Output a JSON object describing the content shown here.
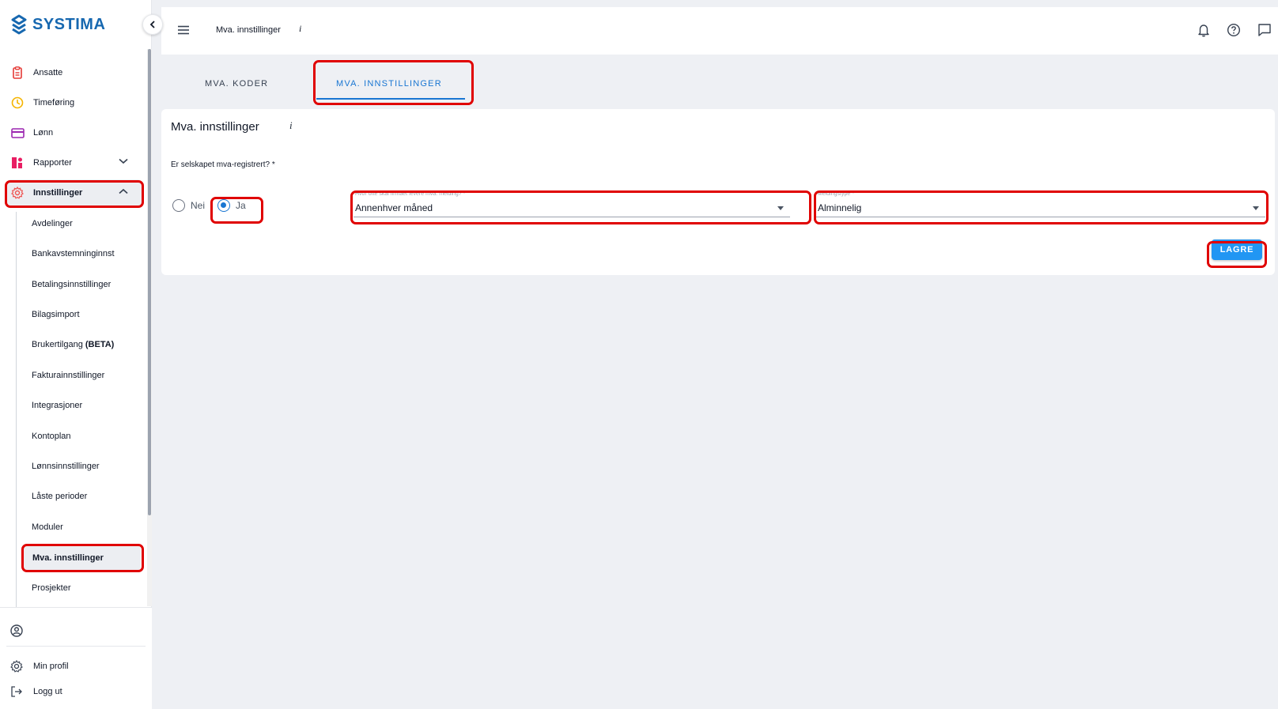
{
  "brand": {
    "name": "SYSTIMA",
    "color": "#1768b0"
  },
  "sidebar": {
    "items": [
      {
        "label": "Ansatte",
        "icon": "clipboard-icon",
        "color": "#e53935"
      },
      {
        "label": "Timeføring",
        "icon": "clock-icon",
        "color": "#f5b400"
      },
      {
        "label": "Lønn",
        "icon": "credit-card-icon",
        "color": "#9c27b0"
      },
      {
        "label": "Rapporter",
        "icon": "chart-icon",
        "color": "#e91e63"
      },
      {
        "label": "Innstillinger",
        "icon": "gear-icon",
        "color": "#ef5350"
      }
    ],
    "subitems": [
      "Avdelinger",
      "Bankavstemninginnst",
      "Betalingsinnstillinger",
      "Bilagsimport",
      "Brukertilgang",
      "Fakturainnstillinger",
      "Integrasjoner",
      "Kontoplan",
      "Lønnsinnstillinger",
      "Låste perioder",
      "Moduler",
      "Mva. innstillinger",
      "Prosjekter"
    ],
    "beta_tag": "(BETA)",
    "bottom": {
      "profile": "Min profil",
      "logout": "Logg ut"
    }
  },
  "topbar": {
    "title": "Mva. innstillinger",
    "info": "i"
  },
  "tabs": {
    "koder": "MVA. KODER",
    "innstillinger": "MVA. INNSTILLINGER"
  },
  "card": {
    "title": "Mva. innstillinger",
    "info": "i",
    "question": "Er selskapet mva-registrert? *",
    "radio_no": "Nei",
    "radio_yes": "Ja",
    "selected": "Ja",
    "frequency": {
      "label": "Hvor ofte skal firmaet levere mva. melding? *",
      "value": "Annenhver måned"
    },
    "type": {
      "label": "Meldingstype *",
      "value": "Alminnelig"
    },
    "save": "LAGRE"
  },
  "colors": {
    "accent": "#1976d2",
    "button": "#2196f3",
    "annotation": "#e00000"
  }
}
